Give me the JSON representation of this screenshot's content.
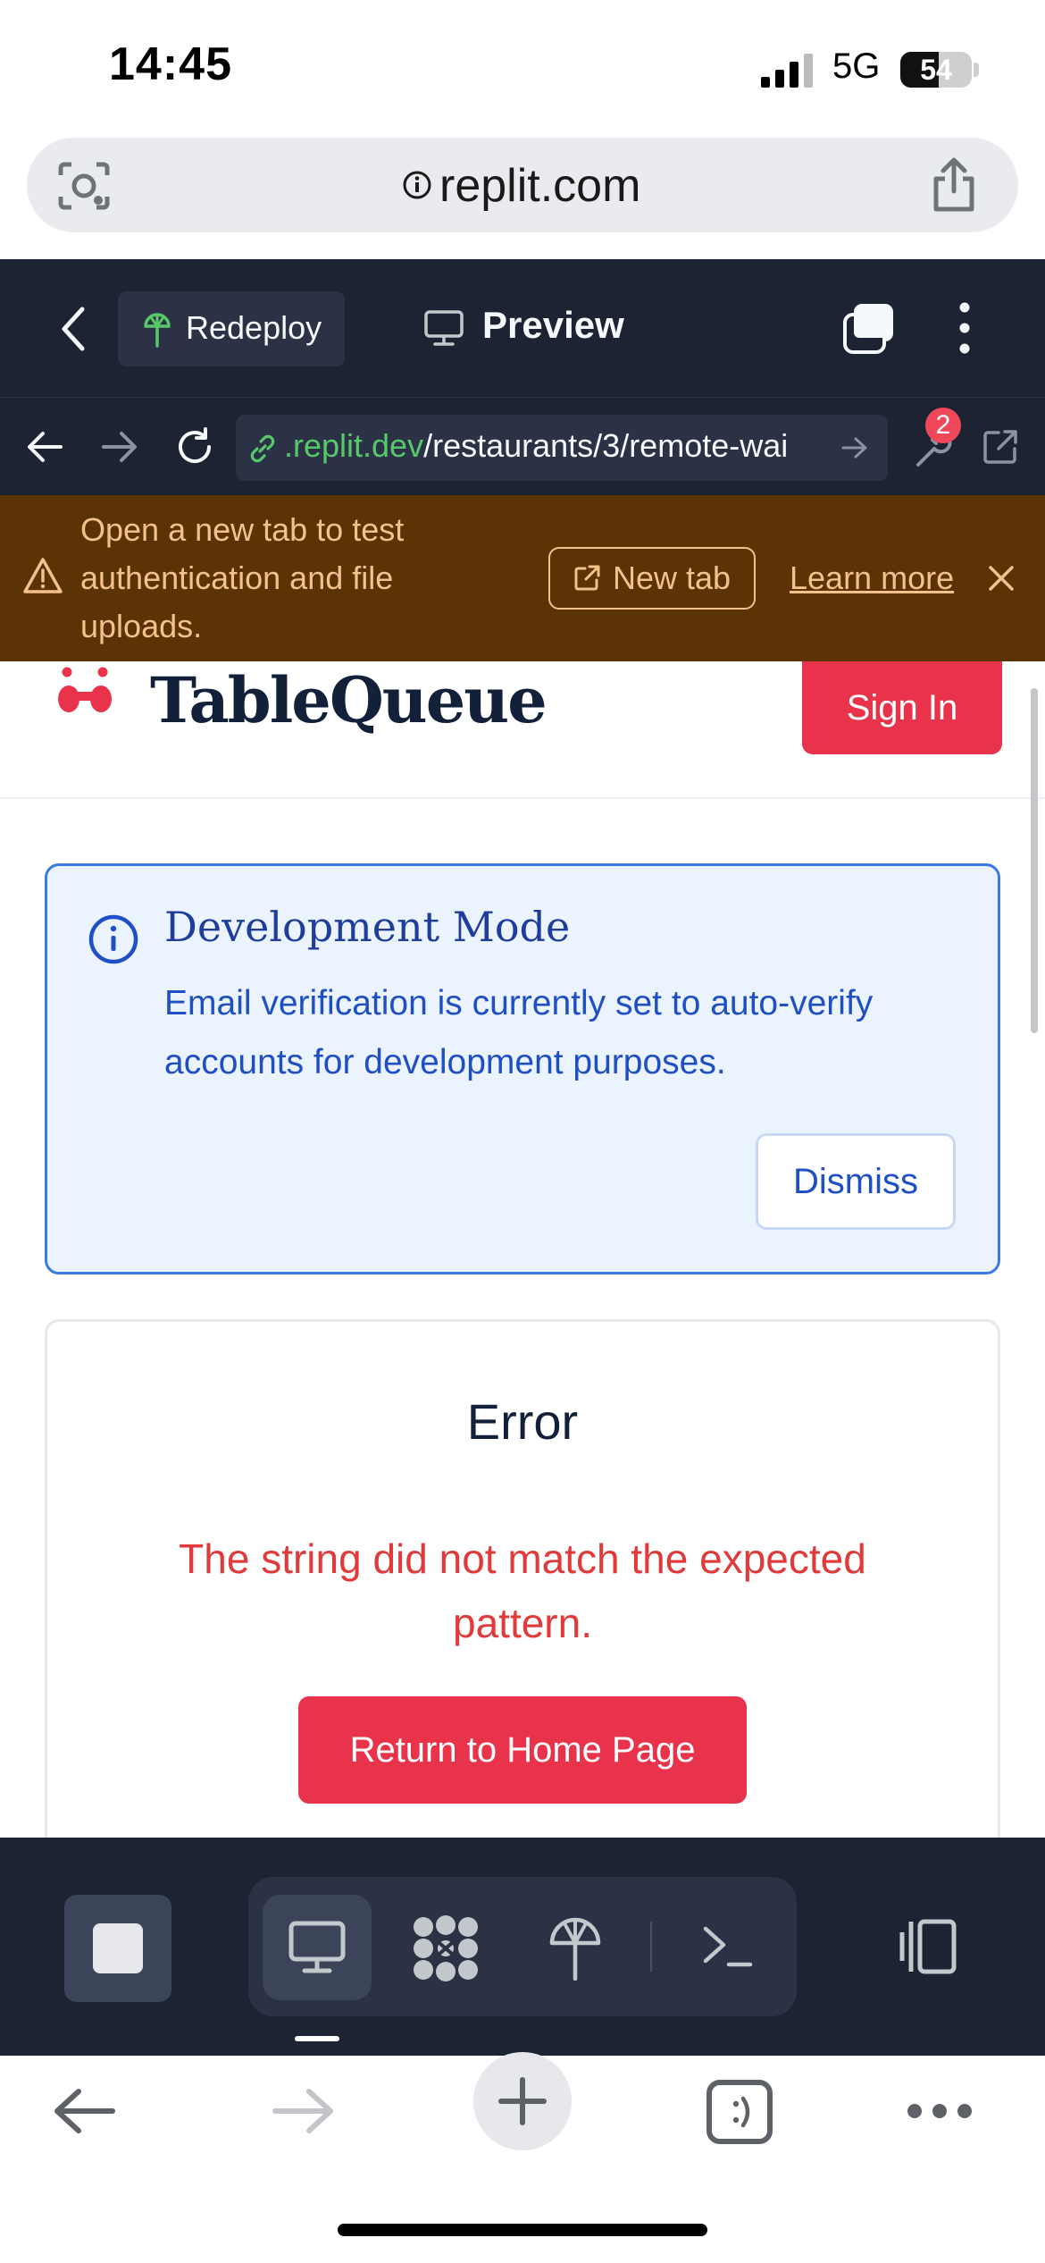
{
  "status_bar": {
    "time": "14:45",
    "network": "5G",
    "battery": "54",
    "battery_level": 0.54
  },
  "browser": {
    "url": "replit.com"
  },
  "replit": {
    "redeploy_label": "Redeploy",
    "preview_label": "Preview",
    "url_host": ".replit.dev",
    "url_path": "/restaurants/3/remote-wai",
    "notification_count": "2"
  },
  "banner": {
    "message": "Open a new tab to test authentication and file uploads.",
    "new_tab_label": "New tab",
    "learn_more_label": "Learn more"
  },
  "app": {
    "brand": "TableQueue",
    "sign_in_label": "Sign In",
    "dev_alert": {
      "title": "Development Mode",
      "body": "Email verification is currently set to auto-verify accounts for development purposes.",
      "dismiss_label": "Dismiss"
    },
    "error": {
      "title": "Error",
      "message": "The string did not match the expected pattern.",
      "home_button_label": "Return to Home Page"
    }
  },
  "colors": {
    "replit_dark": "#1c2333",
    "banner_brown": "#5c3305",
    "brand_red": "#e9334a",
    "info_blue": "#3b7ae0",
    "error_red": "#e03a3a"
  }
}
